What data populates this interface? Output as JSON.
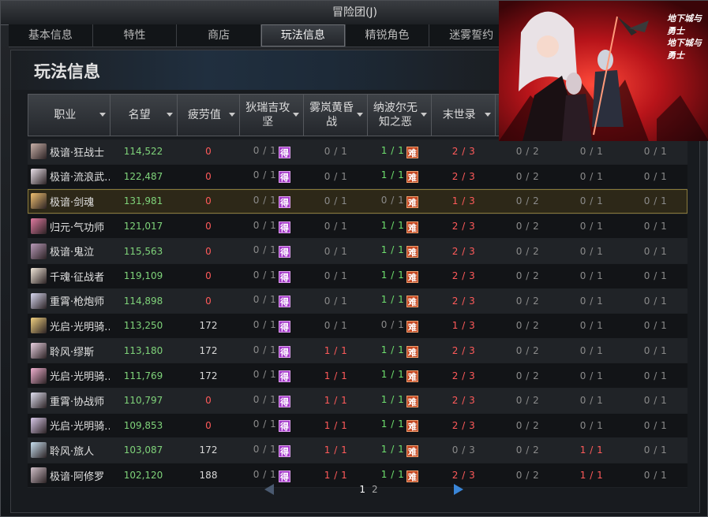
{
  "window": {
    "title": "冒险团(J)"
  },
  "tabs": [
    {
      "label": "基本信息",
      "active": false
    },
    {
      "label": "特性",
      "active": false
    },
    {
      "label": "商店",
      "active": false
    },
    {
      "label": "玩法信息",
      "active": true
    },
    {
      "label": "精锐角色",
      "active": false
    },
    {
      "label": "迷雾誓约",
      "active": false
    }
  ],
  "section_title": "玩法信息",
  "columns": [
    {
      "label": "职业"
    },
    {
      "label": "名望"
    },
    {
      "label": "疲劳值"
    },
    {
      "label": "狄瑞吉攻坚"
    },
    {
      "label": "雾岚黄昏战"
    },
    {
      "label": "纳波尔无知之恶"
    },
    {
      "label": "末世录"
    },
    {
      "label": ""
    },
    {
      "label": ""
    },
    {
      "label": ""
    }
  ],
  "rows": [
    {
      "job": "极谙·狂战士",
      "fame": "114,522",
      "fatigue": "0",
      "q1": "0 / 1",
      "q1b": "p",
      "q2": "0 / 1",
      "q3": "1 / 1",
      "q3b": "o",
      "q4": "2 / 3",
      "q5": "0 / 2",
      "q6": "0 / 1",
      "q7": "0 / 1",
      "selected": false
    },
    {
      "job": "极谙·流浪武…",
      "fame": "122,487",
      "fatigue": "0",
      "q1": "0 / 1",
      "q1b": "p",
      "q2": "0 / 1",
      "q3": "1 / 1",
      "q3b": "o",
      "q4": "2 / 3",
      "q5": "0 / 2",
      "q6": "0 / 1",
      "q7": "0 / 1",
      "selected": false
    },
    {
      "job": "极谙·剑魂",
      "fame": "131,981",
      "fatigue": "0",
      "q1": "0 / 1",
      "q1b": "p",
      "q2": "0 / 1",
      "q3": "0 / 1",
      "q3b": "o",
      "q4": "1 / 3",
      "q5": "0 / 2",
      "q6": "0 / 1",
      "q7": "0 / 1",
      "selected": true
    },
    {
      "job": "归元·气功师",
      "fame": "121,017",
      "fatigue": "0",
      "q1": "0 / 1",
      "q1b": "p",
      "q2": "0 / 1",
      "q3": "1 / 1",
      "q3b": "o",
      "q4": "2 / 3",
      "q5": "0 / 2",
      "q6": "0 / 1",
      "q7": "0 / 1",
      "selected": false
    },
    {
      "job": "极谙·鬼泣",
      "fame": "115,563",
      "fatigue": "0",
      "q1": "0 / 1",
      "q1b": "p",
      "q2": "0 / 1",
      "q3": "1 / 1",
      "q3b": "o",
      "q4": "2 / 3",
      "q5": "0 / 2",
      "q6": "0 / 1",
      "q7": "0 / 1",
      "selected": false
    },
    {
      "job": "千魂·征战者",
      "fame": "119,109",
      "fatigue": "0",
      "q1": "0 / 1",
      "q1b": "p",
      "q2": "0 / 1",
      "q3": "1 / 1",
      "q3b": "o",
      "q4": "2 / 3",
      "q5": "0 / 2",
      "q6": "0 / 1",
      "q7": "0 / 1",
      "selected": false
    },
    {
      "job": "重霄·枪炮师",
      "fame": "114,898",
      "fatigue": "0",
      "q1": "0 / 1",
      "q1b": "p",
      "q2": "0 / 1",
      "q3": "1 / 1",
      "q3b": "o",
      "q4": "2 / 3",
      "q5": "0 / 2",
      "q6": "0 / 1",
      "q7": "0 / 1",
      "selected": false
    },
    {
      "job": "光启·光明骑…",
      "fame": "113,250",
      "fatigue": "172",
      "q1": "0 / 1",
      "q1b": "p",
      "q2": "0 / 1",
      "q3": "0 / 1",
      "q3b": "o",
      "q4": "1 / 3",
      "q5": "0 / 2",
      "q6": "0 / 1",
      "q7": "0 / 1",
      "selected": false
    },
    {
      "job": "聆风·缪斯",
      "fame": "113,180",
      "fatigue": "172",
      "q1": "0 / 1",
      "q1b": "p",
      "q2": "1 / 1",
      "q3": "1 / 1",
      "q3b": "o",
      "q4": "2 / 3",
      "q5": "0 / 2",
      "q6": "0 / 1",
      "q7": "0 / 1",
      "selected": false
    },
    {
      "job": "光启·光明骑…",
      "fame": "111,769",
      "fatigue": "172",
      "q1": "0 / 1",
      "q1b": "p",
      "q2": "1 / 1",
      "q3": "1 / 1",
      "q3b": "o",
      "q4": "2 / 3",
      "q5": "0 / 2",
      "q6": "0 / 1",
      "q7": "0 / 1",
      "selected": false
    },
    {
      "job": "重霄·协战师",
      "fame": "110,797",
      "fatigue": "0",
      "q1": "0 / 1",
      "q1b": "p",
      "q2": "1 / 1",
      "q3": "1 / 1",
      "q3b": "o",
      "q4": "2 / 3",
      "q5": "0 / 2",
      "q6": "0 / 1",
      "q7": "0 / 1",
      "selected": false
    },
    {
      "job": "光启·光明骑…",
      "fame": "109,853",
      "fatigue": "0",
      "q1": "0 / 1",
      "q1b": "p",
      "q2": "1 / 1",
      "q3": "1 / 1",
      "q3b": "o",
      "q4": "2 / 3",
      "q5": "0 / 2",
      "q6": "0 / 1",
      "q7": "0 / 1",
      "selected": false
    },
    {
      "job": "聆风·旅人",
      "fame": "103,087",
      "fatigue": "172",
      "q1": "0 / 1",
      "q1b": "p",
      "q2": "1 / 1",
      "q3": "1 / 1",
      "q3b": "o",
      "q4": "0 / 3",
      "q5": "0 / 2",
      "q6": "1 / 1",
      "q7": "0 / 1",
      "selected": false
    },
    {
      "job": "极谙·阿修罗",
      "fame": "102,120",
      "fatigue": "188",
      "q1": "0 / 1",
      "q1b": "p",
      "q2": "1 / 1",
      "q3": "1 / 1",
      "q3b": "o",
      "q4": "2 / 3",
      "q5": "0 / 2",
      "q6": "1 / 1",
      "q7": "0 / 1",
      "selected": false
    }
  ],
  "badges": {
    "p": "得",
    "o": "难"
  },
  "pagination": {
    "current": "1",
    "other": "2"
  },
  "art": {
    "logo1": "地下城与勇士",
    "logo2": "地下城与勇士"
  },
  "colors": {
    "fame": "#7fd37a",
    "green": "#6ee06e",
    "red": "#ff5a5a",
    "accent": "#3a86d8"
  }
}
